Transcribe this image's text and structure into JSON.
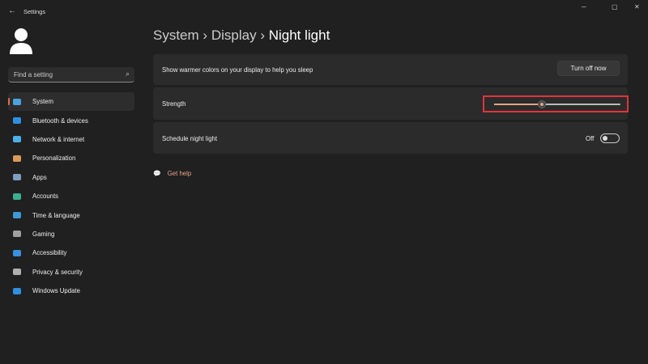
{
  "window": {
    "title": "Settings",
    "back": "←",
    "minimize": "─",
    "maximize": "▢",
    "close": "✕"
  },
  "search": {
    "placeholder": "Find a setting",
    "icon": "search-icon"
  },
  "nav": [
    {
      "label": "System",
      "color": "#4aa3df",
      "active": true
    },
    {
      "label": "Bluetooth & devices",
      "color": "#2f8fe0"
    },
    {
      "label": "Network & internet",
      "color": "#4ab0e8"
    },
    {
      "label": "Personalization",
      "color": "#d99a5a"
    },
    {
      "label": "Apps",
      "color": "#7f9fc0"
    },
    {
      "label": "Accounts",
      "color": "#3bb08f"
    },
    {
      "label": "Time & language",
      "color": "#3c9ad8"
    },
    {
      "label": "Gaming",
      "color": "#a0a0a0"
    },
    {
      "label": "Accessibility",
      "color": "#3a8fe0"
    },
    {
      "label": "Privacy & security",
      "color": "#b0b0b0"
    },
    {
      "label": "Windows Update",
      "color": "#2f8fe0"
    }
  ],
  "breadcrumb": {
    "system": "System",
    "sep": "›",
    "display": "Display",
    "current": "Night light"
  },
  "cards": {
    "warmer": {
      "label": "Show warmer colors on your display to help you sleep",
      "button": "Turn off now"
    },
    "strength": {
      "label": "Strength",
      "value_percent": 38
    },
    "schedule": {
      "label": "Schedule night light",
      "state": "Off"
    }
  },
  "help": {
    "label": "Get help"
  },
  "colors": {
    "accent": "#e8a286",
    "highlight": "#e0343f"
  }
}
